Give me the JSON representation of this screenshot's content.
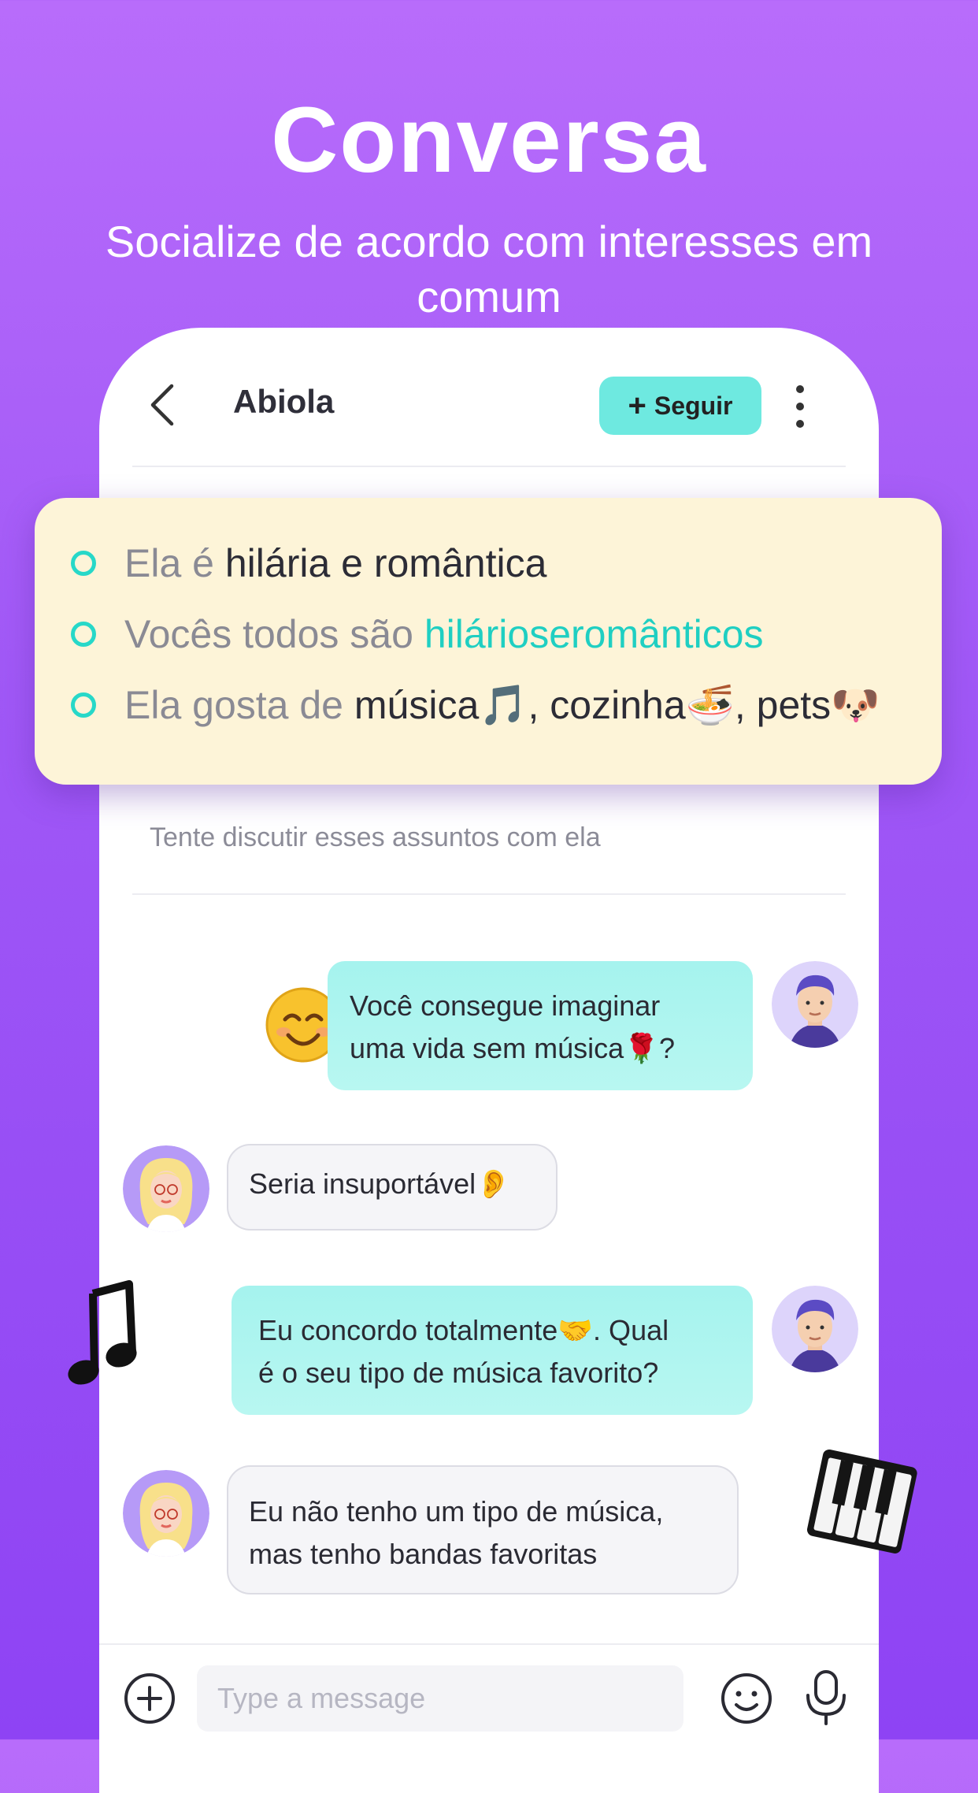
{
  "hero": {
    "title": "Conversa",
    "subtitle": "Socialize de acordo com interesses em comum"
  },
  "chat": {
    "contact_name": "Abiola",
    "follow_label": "Seguir",
    "follow_icon": "plus-icon",
    "hint": "Tente discutir esses assuntos com ela",
    "messages": [
      {
        "from": "me",
        "text": "Você consegue imaginar\numa vida sem música🌹?"
      },
      {
        "from": "her",
        "text": "Seria insuportável👂"
      },
      {
        "from": "me",
        "text": "Eu concordo totalmente🤝. Qual\né o seu tipo de música favorito?"
      },
      {
        "from": "her",
        "text": "Eu não tenho um tipo de música,\nmas tenho bandas favoritas"
      }
    ],
    "input_placeholder": "Type a message"
  },
  "interests": {
    "row1": {
      "prefix": "Ela é ",
      "highlight": "hilária e romântica"
    },
    "row2": {
      "prefix": "Vocês todos são ",
      "highlight": "hilárioseromânticos_placeholder"
    },
    "row3": {
      "prefix": "Ela gosta de ",
      "highlight": "música🎵, cozinha🍜, pets🐶"
    }
  },
  "colors": {
    "background_top": "#b86cfb",
    "background_bottom": "#8e43f4",
    "follow_button": "#6ee9e0",
    "accent": "#1fcfc2",
    "card_background": "#fdf4d8",
    "outgoing_bubble": "#a5f3ee"
  }
}
